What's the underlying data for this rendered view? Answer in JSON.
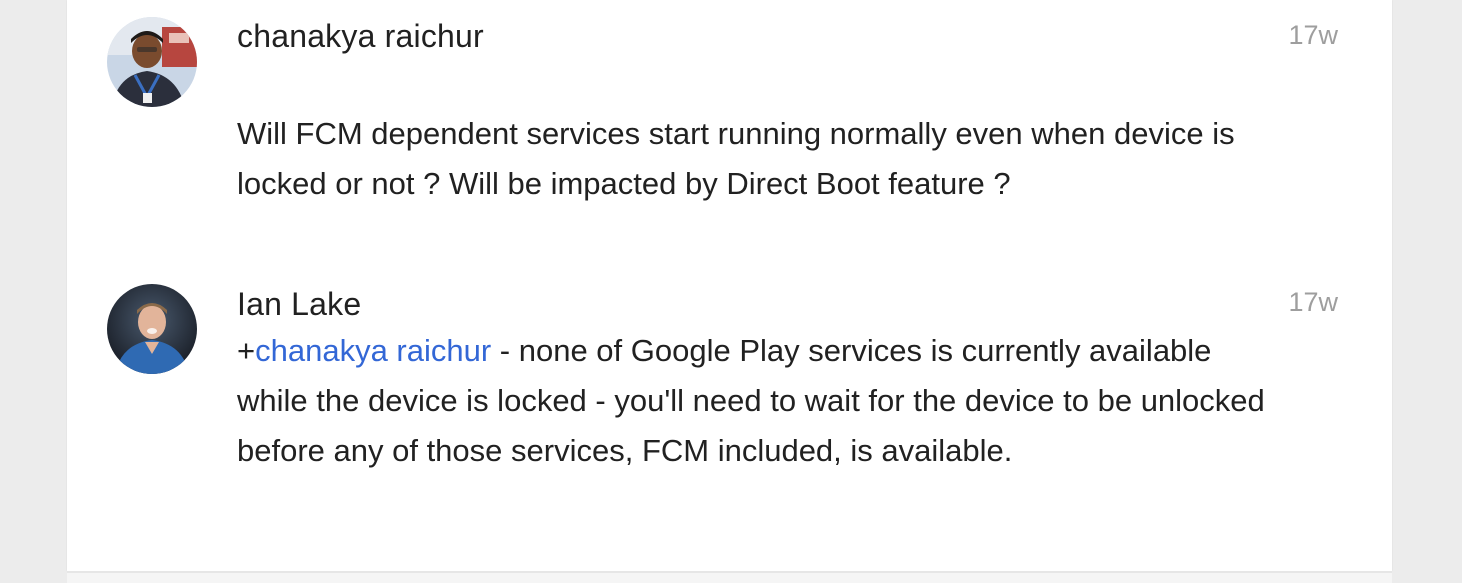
{
  "comments": [
    {
      "author": "chanakya raichur",
      "timestamp": "17w",
      "body": "Will FCM dependent services  start running normally even when device is locked or not ? Will be impacted by Direct Boot feature ?"
    },
    {
      "author": "Ian Lake",
      "timestamp": "17w",
      "mention_prefix": "+",
      "mention_name": "chanakya raichur",
      "body": " - none of Google Play services is currently available while the device is locked - you'll need to wait for the device to be unlocked before any of those services, FCM included, is available."
    }
  ],
  "colors": {
    "link": "#3367d6",
    "timestamp": "#9e9e9e",
    "text": "#212121",
    "background": "#ececec",
    "card": "#ffffff"
  },
  "icons": {
    "avatar_1": "user-photo-avatar",
    "avatar_2": "user-photo-avatar"
  }
}
